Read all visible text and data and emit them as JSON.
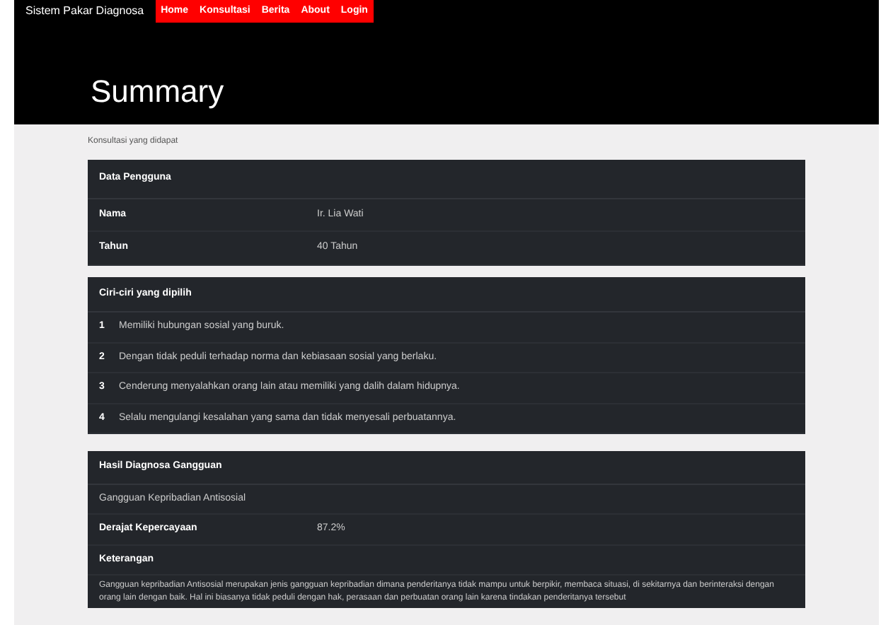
{
  "navbar": {
    "brand": "Sistem Pakar Diagnosa",
    "links": [
      {
        "label": "Home"
      },
      {
        "label": "Konsultasi"
      },
      {
        "label": "Berita"
      },
      {
        "label": "About"
      },
      {
        "label": "Login"
      }
    ]
  },
  "page_title": "Summary",
  "subtitle": "Konsultasi yang didapat",
  "user_card": {
    "title": "Data Pengguna",
    "rows": [
      {
        "label": "Nama",
        "value": "Ir. Lia Wati"
      },
      {
        "label": "Tahun",
        "value": "40 Tahun"
      }
    ]
  },
  "traits_card": {
    "title": "Ciri-ciri yang dipilih",
    "items": [
      {
        "number": "1",
        "text": "Memiliki hubungan sosial yang buruk."
      },
      {
        "number": "2",
        "text": "Dengan tidak peduli terhadap norma dan kebiasaan sosial yang berlaku."
      },
      {
        "number": "3",
        "text": "Cenderung menyalahkan orang lain atau memiliki yang dalih dalam hidupnya."
      },
      {
        "number": "4",
        "text": "Selalu mengulangi kesalahan yang sama dan tidak menyesali perbuatannya."
      }
    ]
  },
  "result_card": {
    "title": "Hasil Diagnosa Gangguan",
    "diagnosis": "Gangguan Kepribadian Antisosial",
    "confidence_label": "Derajat Kepercayaan",
    "confidence_value": "87.2%",
    "notes_label": "Keterangan",
    "notes": "Gangguan kepribadian Antisosial merupakan jenis gangguan kepribadian dimana penderitanya tidak mampu untuk berpikir, membaca situasi, di sekitarnya dan berinteraksi dengan orang lain dengan baik. Hal ini biasanya tidak peduli dengan hak, perasaan dan perbuatan orang lain karena tindakan penderitanya tersebut"
  }
}
